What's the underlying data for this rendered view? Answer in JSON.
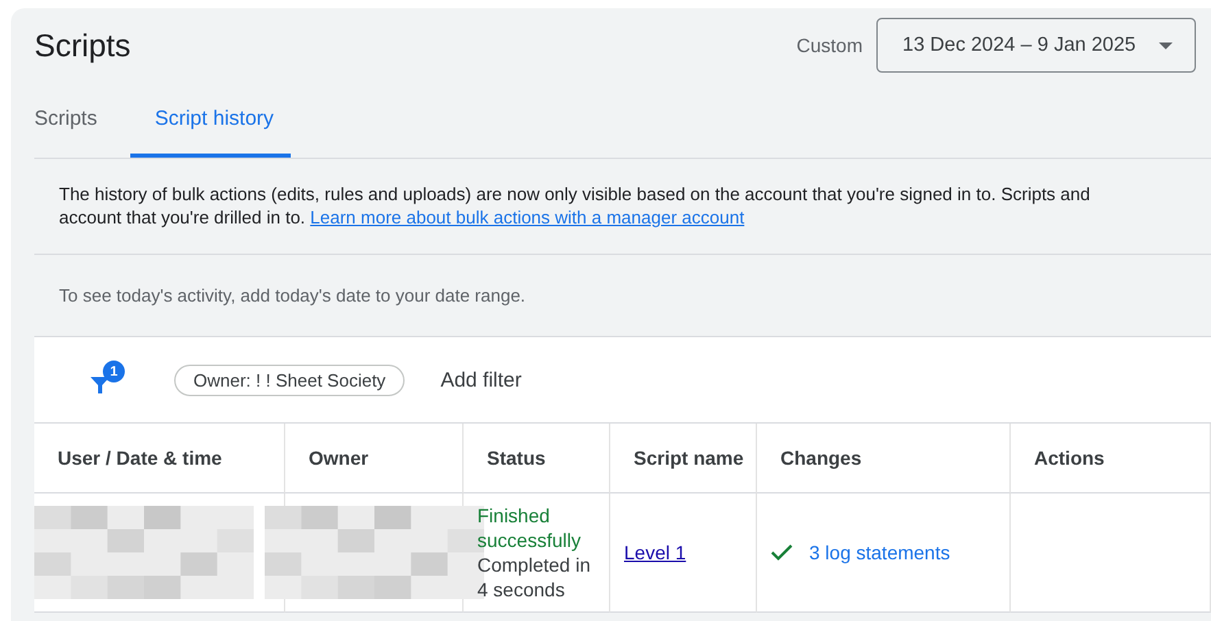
{
  "header": {
    "title": "Scripts",
    "range_label": "Custom",
    "date_range": "13 Dec 2024 – 9 Jan 2025"
  },
  "tabs": [
    {
      "label": "Scripts",
      "selected": false
    },
    {
      "label": "Script history",
      "selected": true
    }
  ],
  "notice": {
    "text": "The history of bulk actions (edits, rules and uploads) are now only visible based on the account that you're signed in to. Scripts and\naccount that you're drilled in to. ",
    "link": "Learn more about bulk actions with a manager account"
  },
  "hint": "To see today's activity, add today's date to your date range.",
  "filters": {
    "badge": "1",
    "chips": [
      "Owner: ! ! Sheet Society"
    ],
    "add_label": "Add filter"
  },
  "table": {
    "columns": [
      "User / Date & time",
      "Owner",
      "Status",
      "Script name",
      "Changes",
      "Actions"
    ],
    "rows": [
      {
        "status": "Finished successfully",
        "status_detail": "Completed in 4 seconds",
        "script": "Level 1",
        "changes": "3 log statements"
      }
    ]
  }
}
